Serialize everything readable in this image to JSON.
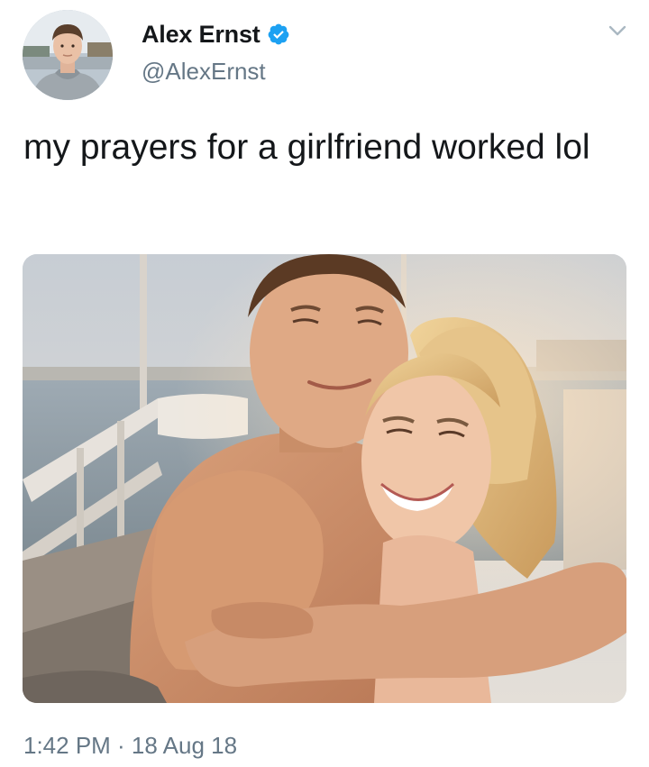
{
  "tweet": {
    "author": {
      "display_name": "Alex Ernst",
      "handle": "@AlexErnst",
      "verified": true,
      "verified_icon": "verified-badge-icon",
      "avatar_icon": "avatar"
    },
    "menu_icon": "chevron-down-icon",
    "text": "my prayers for a girlfriend worked lol",
    "media": {
      "kind": "photo",
      "subject": "couple-hug-photo"
    },
    "timestamp": "1:42 PM · 18 Aug 18"
  },
  "colors": {
    "text_primary": "#14171a",
    "text_secondary": "#657786",
    "verified_blue": "#1da1f2",
    "chevron_gray": "#aab8c2"
  }
}
